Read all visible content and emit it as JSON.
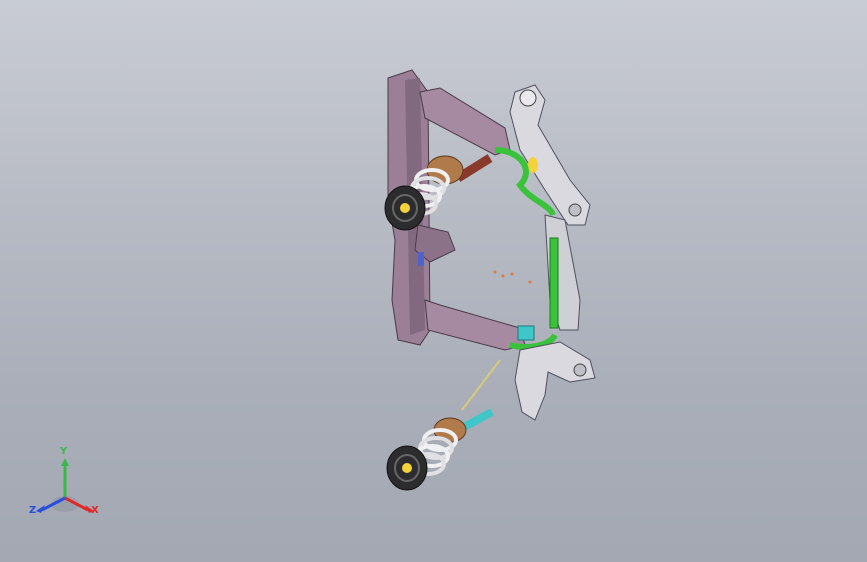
{
  "viewport": {
    "background_top": "#c9ccd4",
    "background_bottom": "#a3a8b3"
  },
  "model": {
    "description_icon": "suspension-assembly-model",
    "colors": {
      "subframe": "#9a7f96",
      "subframe_dark": "#6d566b",
      "spring": "#e8e8ea",
      "damper": "#8a3a2a",
      "tie_rod": "#39c33a",
      "control_arm": "#d9d9df",
      "knuckle": "#3fc6c9",
      "hub_yellow": "#f3d23a",
      "markers": "#e07b3a"
    }
  },
  "triad": {
    "x_label": "X",
    "y_label": "Y",
    "z_label": "Z",
    "x_color": "#e02a2a",
    "y_color": "#3bb84a",
    "z_color": "#2a4fe0"
  }
}
